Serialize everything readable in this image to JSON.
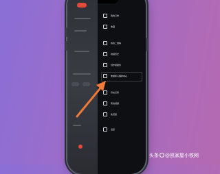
{
  "screen": {
    "badge_text": "",
    "menu": {
      "items": [
        {
          "label": "我的订单",
          "icon": "order-icon"
        },
        {
          "label": "收藏",
          "icon": "star-icon"
        },
        {
          "label": "我的二维码",
          "icon": "qrcode-icon"
        },
        {
          "label": "视频历史",
          "icon": "history-icon"
        },
        {
          "label": "创作者服务",
          "icon": "creator-icon"
        },
        {
          "label": "未成年人保护中心",
          "icon": "shield-icon"
        },
        {
          "label": "好友记录",
          "icon": "friends-icon"
        },
        {
          "label": "离线视频",
          "icon": "download-icon"
        },
        {
          "label": "免流量",
          "icon": "wifi-icon"
        },
        {
          "label": "设置",
          "icon": "gear-icon"
        }
      ],
      "highlighted_index": 5
    }
  },
  "watermark": {
    "prefix": "头条",
    "handle": "@凯家屋小铁网"
  },
  "colors": {
    "arrow": "#f07a3a",
    "badge": "#e24a3b"
  }
}
